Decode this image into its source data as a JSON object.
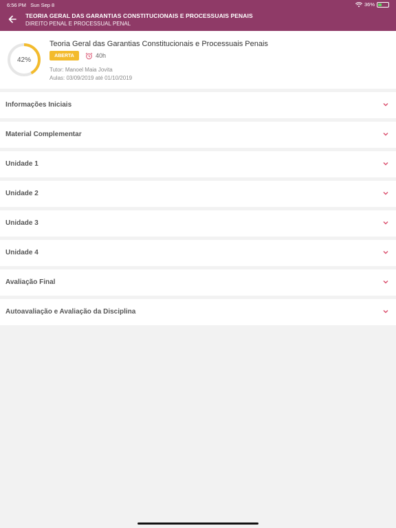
{
  "status_bar": {
    "time": "6:56 PM",
    "date": "Sun Sep 8",
    "battery": "36%",
    "battery_level": 0.36
  },
  "header": {
    "title": "TEORIA GERAL DAS GARANTIAS CONSTITUCIONAIS E PROCESSUAIS PENAIS",
    "subtitle": "DIREITO PENAL E PROCESSUAL PENAL",
    "back_icon": "arrow-left-icon"
  },
  "course": {
    "progress": 42,
    "progress_label": "42%",
    "title": "Teoria Geral das Garantias Constitucionais e Processuais Penais",
    "status": "ABERTA",
    "hours": "40h",
    "tutor": "Tutor: Manoel Maia Jovita",
    "aulas": "Aulas: 03/09/2019 até 01/10/2019"
  },
  "sections": [
    {
      "label": "Informações Iniciais"
    },
    {
      "label": "Material Complementar"
    },
    {
      "label": "Unidade 1"
    },
    {
      "label": "Unidade 2"
    },
    {
      "label": "Unidade 3"
    },
    {
      "label": "Unidade 4"
    },
    {
      "label": "Avaliação Final"
    },
    {
      "label": "Autoavaliação e Avaliação da Disciplina"
    }
  ],
  "colors": {
    "header": "#8f3a67",
    "accent": "#f3bb2d",
    "chevron": "#d94b6a"
  }
}
